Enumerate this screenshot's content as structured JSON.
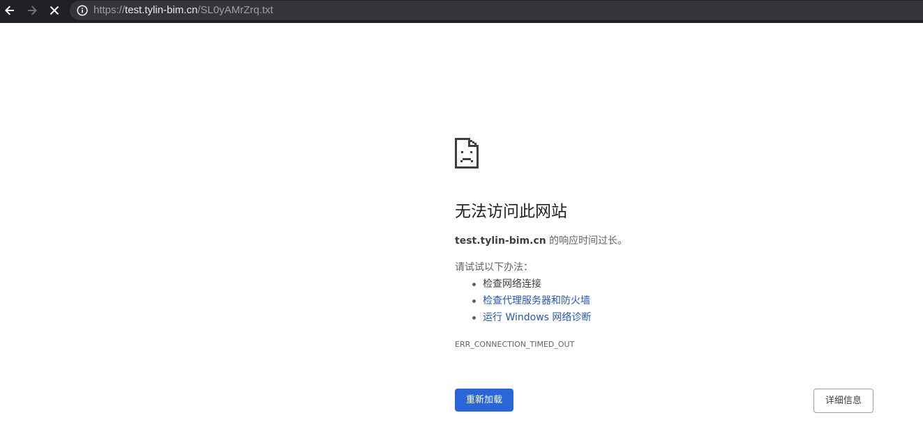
{
  "browser": {
    "url_scheme": "https://",
    "url_host": "test.tylin-bim.cn",
    "url_path": "/SL0yAMrZrq.txt",
    "icons": {
      "back": "arrow-left-icon",
      "forward": "arrow-right-icon",
      "stop": "close-icon",
      "site_info": "info-icon"
    }
  },
  "error_page": {
    "icon": "sad-document-icon",
    "title": "无法访问此网站",
    "description_host": "test.tylin-bim.cn",
    "description_text": " 的响应时间过长。",
    "suggestions_heading": "请试试以下办法：",
    "suggestions": [
      {
        "label": "检查网络连接",
        "link": false
      },
      {
        "label": "检查代理服务器和防火墙",
        "link": true
      },
      {
        "label": "运行 Windows 网络诊断",
        "link": true
      }
    ],
    "error_code": "ERR_CONNECTION_TIMED_OUT",
    "reload_label": "重新加载",
    "details_label": "详细信息",
    "colors": {
      "toolbar_bg": "#202124",
      "primary_button": "#2a66d8",
      "link": "#2458b5"
    }
  }
}
